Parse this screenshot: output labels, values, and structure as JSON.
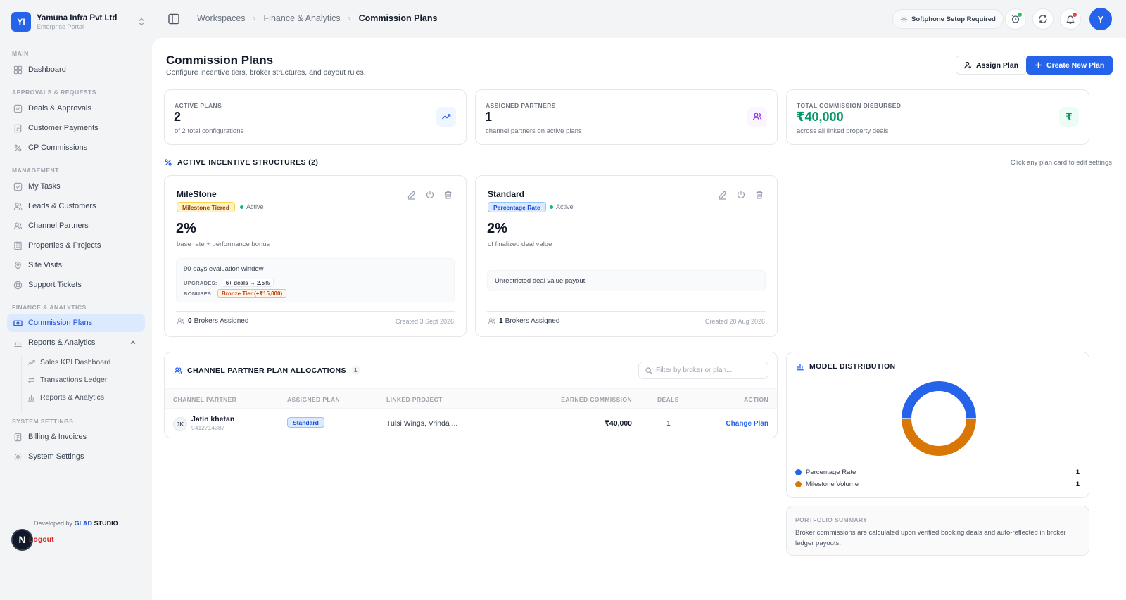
{
  "brand": {
    "logo": "YI",
    "name": "Yamuna Infra Pvt Ltd",
    "subtitle": "Enterprise Portal"
  },
  "sidebar": {
    "sections": {
      "main": "MAIN",
      "approvals": "APPROVALS & REQUESTS",
      "management": "MANAGEMENT",
      "finance": "FINANCE & ANALYTICS",
      "system": "SYSTEM SETTINGS"
    },
    "items": {
      "dashboard": "Dashboard",
      "deals": "Deals & Approvals",
      "payments": "Customer Payments",
      "cp_commissions": "CP Commissions",
      "tasks": "My Tasks",
      "leads": "Leads & Customers",
      "channel_partners": "Channel Partners",
      "properties": "Properties & Projects",
      "site_visits": "Site Visits",
      "support": "Support Tickets",
      "commission_plans": "Commission Plans",
      "reports": "Reports & Analytics",
      "sales_kpi": "Sales KPI Dashboard",
      "ledger": "Transactions Ledger",
      "reports_sub": "Reports & Analytics",
      "billing": "Billing & Invoices",
      "system_settings": "System Settings"
    },
    "credit_prefix": "Developed by",
    "credit_glad": "GLAD",
    "credit_studio": "STUDIO",
    "logout": "Logout",
    "n_badge": "N"
  },
  "topbar": {
    "breadcrumbs": [
      "Workspaces",
      "Finance & Analytics",
      "Commission Plans"
    ],
    "softphone": "Softphone Setup Required",
    "avatar": "Y"
  },
  "page": {
    "title": "Commission Plans",
    "subtitle": "Configure incentive tiers, broker structures, and payout rules.",
    "assign_label": "Assign Plan",
    "create_label": "Create New Plan"
  },
  "stats": [
    {
      "label": "ACTIVE PLANS",
      "value": "2",
      "desc": "of 2 total configurations",
      "icon": "trending-up-icon"
    },
    {
      "label": "ASSIGNED PARTNERS",
      "value": "1",
      "desc": "channel partners on active plans",
      "icon": "users-icon"
    },
    {
      "label": "TOTAL COMMISSION DISBURSED",
      "value": "₹40,000",
      "desc": "across all linked property deals",
      "icon": "rupee-icon"
    }
  ],
  "structures": {
    "heading": "ACTIVE INCENTIVE STRUCTURES (2)",
    "hint": "Click any plan card to edit settings",
    "plans": [
      {
        "name": "MileStone",
        "badge": "Milestone Tiered",
        "status": "Active",
        "rate": "2%",
        "rate_sub": "base rate + performance bonus",
        "window": "90 days evaluation window",
        "upgrades_label": "UPGRADES:",
        "upgrades_value": "6+ deals → 2.5%",
        "bonuses_label": "BONUSES:",
        "bonuses_value": "Bronze Tier (+₹15,000)",
        "brokers_count": "0",
        "brokers_label": "Brokers Assigned",
        "created": "Created 3 Sept 2026"
      },
      {
        "name": "Standard",
        "badge": "Percentage Rate",
        "status": "Active",
        "rate": "2%",
        "rate_sub": "of finalized deal value",
        "payout": "Unrestricted deal value payout",
        "brokers_count": "1",
        "brokers_label": "Brokers Assigned",
        "created": "Created 20 Aug 2026"
      }
    ]
  },
  "allocations": {
    "heading": "CHANNEL PARTNER PLAN ALLOCATIONS",
    "count": "1",
    "filter_placeholder": "Filter by broker or plan...",
    "columns": [
      "CHANNEL PARTNER",
      "ASSIGNED PLAN",
      "LINKED PROJECT",
      "EARNED COMMISSION",
      "DEALS",
      "ACTION"
    ],
    "rows": [
      {
        "initials": "JK",
        "name": "Jatin khetan",
        "phone": "9412714387",
        "plan": "Standard",
        "project": "Tulsi Wings, Vrinda ...",
        "commission": "₹40,000",
        "deals": "1",
        "action": "Change Plan"
      }
    ]
  },
  "distribution": {
    "heading": "MODEL DISTRIBUTION",
    "chart_data": {
      "type": "pie",
      "categories": [
        "Percentage Rate",
        "Milestone Volume"
      ],
      "values": [
        1,
        1
      ],
      "colors": [
        "#2563eb",
        "#d97706"
      ],
      "title": "MODEL DISTRIBUTION"
    }
  },
  "portfolio": {
    "title": "PORTFOLIO SUMMARY",
    "text": "Broker commissions are calculated upon verified booking deals and auto-reflected in broker ledger payouts."
  },
  "colors": {
    "accent": "#2563eb",
    "success": "#059669",
    "warning": "#d97706"
  }
}
